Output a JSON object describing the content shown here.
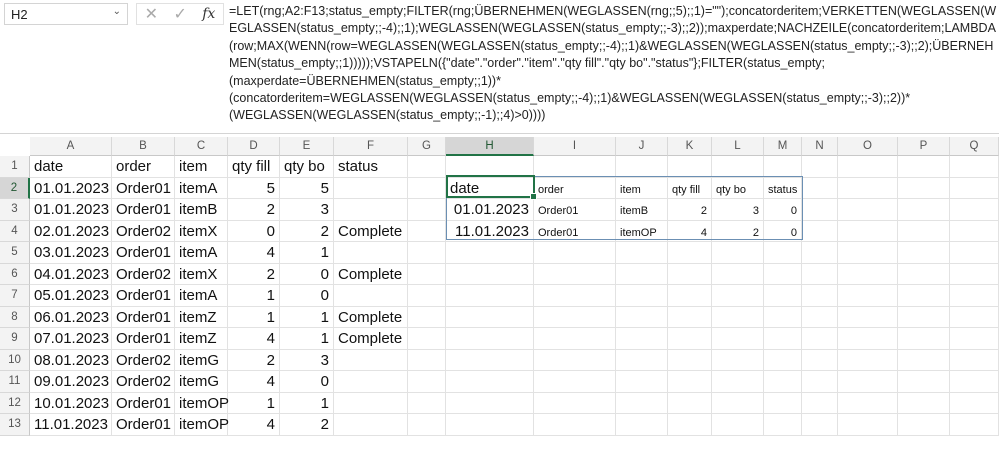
{
  "name_box": "H2",
  "formula": "=LET(rng;A2:F13;status_empty;FILTER(rng;ÜBERNEHMEN(WEGLASSEN(rng;;5);;1)=\"\");concatorderitem;VERKETTEN(WEGLASSEN(WEGLASSEN(status_empty;;-4);;1);WEGLASSEN(WEGLASSEN(status_empty;;-3);;2));maxperdate;NACHZEILE(concatorderitem;LAMBDA(row;MAX(WENN(row=WEGLASSEN(WEGLASSEN(status_empty;;-4);;1)&WEGLASSEN(WEGLASSEN(status_empty;;-3);;2);ÜBERNEHMEN(status_empty;;1)))));VSTAPELN({\"date\".\"order\".\"item\".\"qty fill\".\"qty bo\".\"status\"};FILTER(status_empty;\n(maxperdate=ÜBERNEHMEN(status_empty;;1))*\n(concatorderitem=WEGLASSEN(WEGLASSEN(status_empty;;-4);;1)&WEGLASSEN(WEGLASSEN(status_empty;;-3);;2))*\n(WEGLASSEN(WEGLASSEN(status_empty;;-1);;4)>0))))",
  "columns": [
    "A",
    "B",
    "C",
    "D",
    "E",
    "F",
    "G",
    "H",
    "I",
    "J",
    "K",
    "L",
    "M",
    "N",
    "O",
    "P",
    "Q"
  ],
  "rows": [
    "1",
    "2",
    "3",
    "4",
    "5",
    "6",
    "7",
    "8",
    "9",
    "10",
    "11",
    "12",
    "13"
  ],
  "source": [
    [
      "date",
      "order",
      "item",
      "qty fill",
      "qty bo",
      "status"
    ],
    [
      "01.01.2023",
      "Order01",
      "itemA",
      "5",
      "5",
      ""
    ],
    [
      "01.01.2023",
      "Order01",
      "itemB",
      "2",
      "3",
      ""
    ],
    [
      "02.01.2023",
      "Order02",
      "itemX",
      "0",
      "2",
      "Complete"
    ],
    [
      "03.01.2023",
      "Order01",
      "itemA",
      "4",
      "1",
      ""
    ],
    [
      "04.01.2023",
      "Order02",
      "itemX",
      "2",
      "0",
      "Complete"
    ],
    [
      "05.01.2023",
      "Order01",
      "itemA",
      "1",
      "0",
      ""
    ],
    [
      "06.01.2023",
      "Order01",
      "itemZ",
      "1",
      "1",
      "Complete"
    ],
    [
      "07.01.2023",
      "Order01",
      "itemZ",
      "4",
      "1",
      "Complete"
    ],
    [
      "08.01.2023",
      "Order02",
      "itemG",
      "2",
      "3",
      ""
    ],
    [
      "09.01.2023",
      "Order02",
      "itemG",
      "4",
      "0",
      ""
    ],
    [
      "10.01.2023",
      "Order01",
      "itemOP",
      "1",
      "1",
      ""
    ],
    [
      "11.01.2023",
      "Order01",
      "itemOP",
      "4",
      "2",
      ""
    ]
  ],
  "result": [
    [
      "date",
      "order",
      "item",
      "qty fill",
      "qty bo",
      "status"
    ],
    [
      "01.01.2023",
      "Order01",
      "itemB",
      "2",
      "3",
      "0"
    ],
    [
      "11.01.2023",
      "Order01",
      "itemOP",
      "4",
      "2",
      "0"
    ]
  ]
}
